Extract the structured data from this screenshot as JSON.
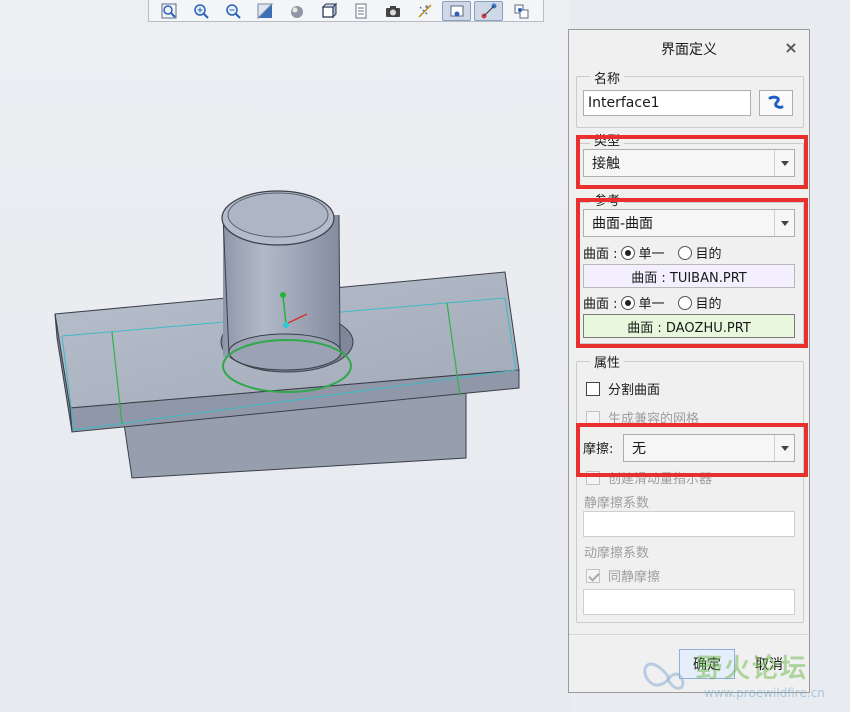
{
  "toolbar": {
    "icons": [
      "zoom-fit-icon",
      "zoom-in-icon",
      "zoom-out-icon",
      "repaint-icon",
      "shading-icon",
      "display-style-icon",
      "saved-views-icon",
      "screenshot-icon",
      "datum-display-icon",
      "spin-center-icon",
      "annotation-display-icon",
      "point-display-icon"
    ]
  },
  "dialog": {
    "title": "界面定义",
    "close": "×",
    "name_group": {
      "label": "名称",
      "value": "Interface1"
    },
    "type_group": {
      "label": "类型",
      "selected": "接触"
    },
    "refs_group": {
      "label": "参考",
      "selected": "曲面-曲面",
      "surface1": {
        "label": "曲面 :",
        "opt_single": "单一",
        "opt_target": "目的",
        "selected": "单一",
        "ref": "曲面 : TUIBAN.PRT"
      },
      "surface2": {
        "label": "曲面 :",
        "opt_single": "单一",
        "opt_target": "目的",
        "selected": "单一",
        "ref": "曲面 : DAOZHU.PRT"
      }
    },
    "props_group": {
      "label": "属性",
      "split_surface": {
        "label": "分割曲面",
        "checked": false
      },
      "compatible_mesh": {
        "label": "生成兼容的网格",
        "checked": false,
        "enabled": false
      },
      "friction": {
        "label": "摩擦:",
        "selected": "无"
      },
      "slip_indicator": {
        "label": "创建滑动量指示器",
        "enabled": false
      },
      "static_coef": {
        "label": "静摩擦系数",
        "value": ""
      },
      "dynamic_coef": {
        "label": "动摩擦系数",
        "value": ""
      },
      "same_as_static": {
        "label": "同静摩擦",
        "checked": true,
        "enabled": false
      },
      "dynamic_value": ""
    },
    "ok": "确定",
    "cancel": "取消"
  },
  "watermark": {
    "text": "野火论坛",
    "url": "www.proewildfire.cn"
  },
  "colors": {
    "highlight": "#e8312f",
    "ref1_bg": "#f3efff",
    "ref2_bg": "#e8f8dc",
    "model": "#9aa2b2"
  }
}
